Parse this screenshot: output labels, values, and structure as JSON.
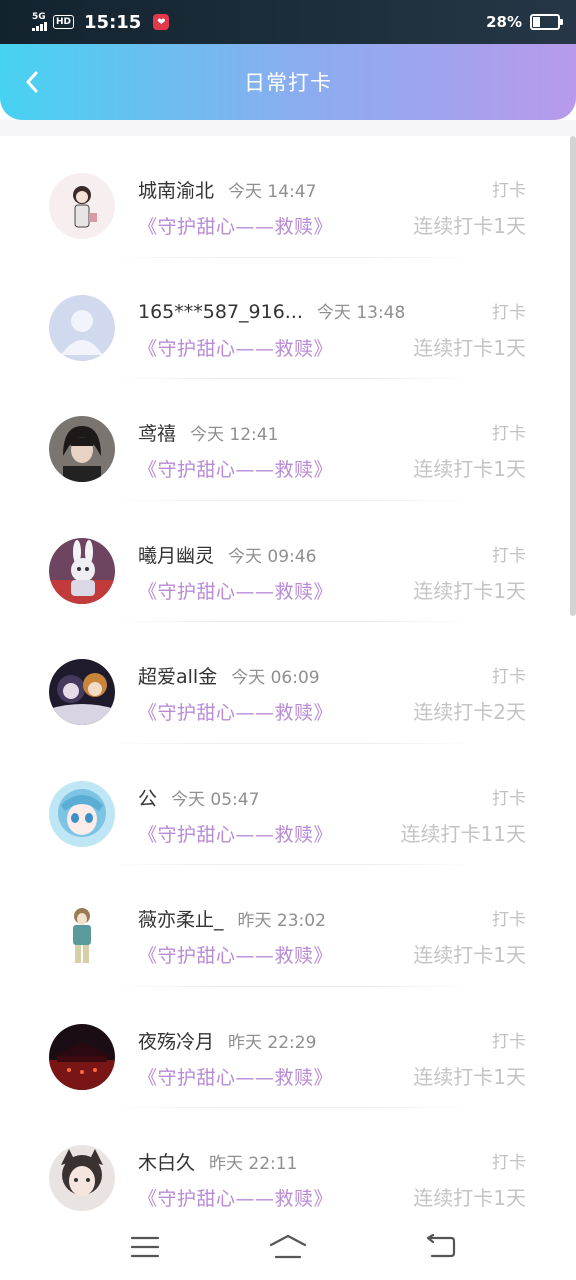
{
  "status_bar": {
    "network": "5G",
    "hd": "HD",
    "time": "15:15",
    "battery_percent": "28%",
    "battery_level": 0.28
  },
  "header": {
    "title": "日常打卡"
  },
  "colors": {
    "header_gradient": [
      "#47d2f2",
      "#88aef0",
      "#b79aeb"
    ],
    "book_title": "#b98bd6"
  },
  "checkins": [
    {
      "name": "城南渝北",
      "time": "今天 14:47",
      "action": "打卡",
      "book": "《守护甜心——救赎》",
      "streak": "连续打卡1天",
      "avatar": "anime-girl-sketch"
    },
    {
      "name": "165***587_916...",
      "time": "今天 13:48",
      "action": "打卡",
      "book": "《守护甜心——救赎》",
      "streak": "连续打卡1天",
      "avatar": "default-user"
    },
    {
      "name": "鸢禧",
      "time": "今天 12:41",
      "action": "打卡",
      "book": "《守护甜心——救赎》",
      "streak": "连续打卡1天",
      "avatar": "dark-hair-boy"
    },
    {
      "name": "曦月幽灵",
      "time": "今天 09:46",
      "action": "打卡",
      "book": "《守护甜心——救赎》",
      "streak": "连续打卡1天",
      "avatar": "bunny-anime"
    },
    {
      "name": "超爱all金",
      "time": "今天 06:09",
      "action": "打卡",
      "book": "《守护甜心——救赎》",
      "streak": "连续打卡2天",
      "avatar": "dark-anime-duo"
    },
    {
      "name": "公",
      "time": "今天 05:47",
      "action": "打卡",
      "book": "《守护甜心——救赎》",
      "streak": "连续打卡11天",
      "avatar": "blue-hair-anime"
    },
    {
      "name": "薇亦柔止_",
      "time": "昨天 23:02",
      "action": "打卡",
      "book": "《守护甜心——救赎》",
      "streak": "连续打卡1天",
      "avatar": "anime-boy-standing"
    },
    {
      "name": "夜殇冷月",
      "time": "昨天 22:29",
      "action": "打卡",
      "book": "《守护甜心——救赎》",
      "streak": "连续打卡1天",
      "avatar": "red-night-scene"
    },
    {
      "name": "木白久",
      "time": "昨天 22:11",
      "action": "打卡",
      "book": "《守护甜心——救赎》",
      "streak": "连续打卡1天",
      "avatar": "cat-ear-girl"
    }
  ],
  "nav": {
    "items": [
      "menu-icon",
      "home-icon",
      "back-icon"
    ]
  }
}
